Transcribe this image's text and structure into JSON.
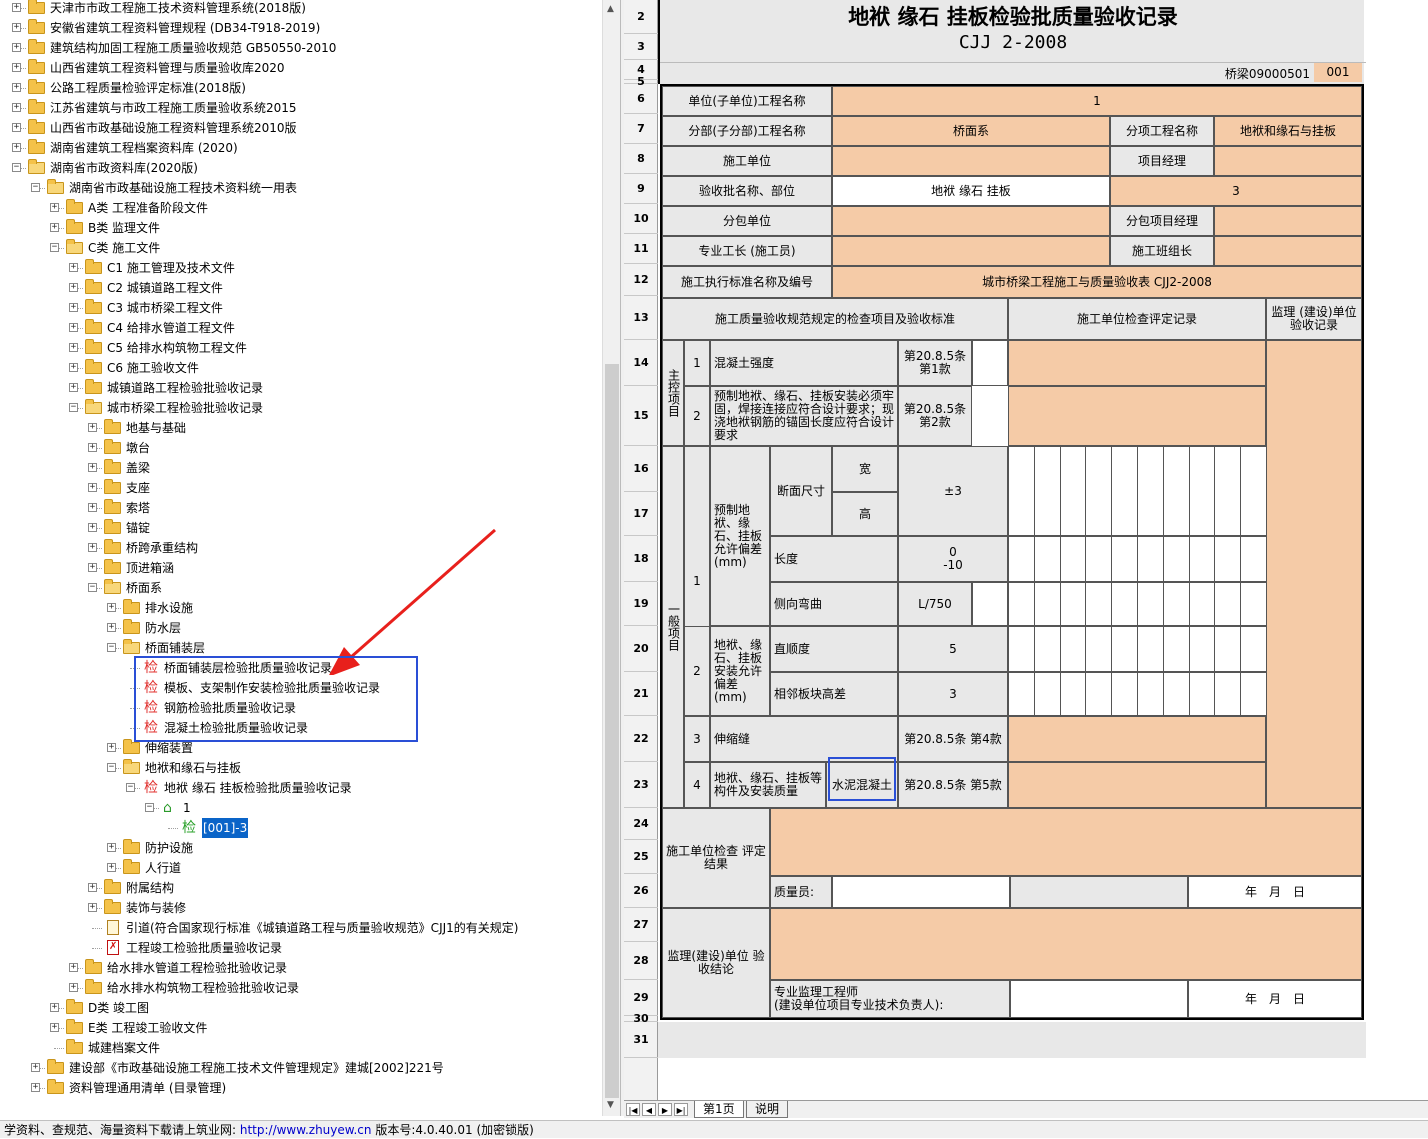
{
  "tree": {
    "items": [
      {
        "label": "天津市市政工程施工技术资料管理系统(2018版)"
      },
      {
        "label": "安徽省建筑工程资料管理规程 (DB34-T918-2019)"
      },
      {
        "label": "建筑结构加固工程施工质量验收规范 GB50550-2010"
      },
      {
        "label": "山西省建筑工程资料管理与质量验收库2020"
      },
      {
        "label": "公路工程质量检验评定标准(2018版)"
      },
      {
        "label": "江苏省建筑与市政工程施工质量验收系统2015"
      },
      {
        "label": "山西省市政基础设施工程资料管理系统2010版"
      },
      {
        "label": "湖南省建筑工程档案资料库 (2020)"
      },
      {
        "label": "湖南省市政资料库(2020版)"
      },
      {
        "label": "湖南省市政基础设施工程技术资料统一用表"
      },
      {
        "label": "A类 工程准备阶段文件"
      },
      {
        "label": "B类 监理文件"
      },
      {
        "label": "C类 施工文件"
      },
      {
        "label": "C1 施工管理及技术文件"
      },
      {
        "label": "C2 城镇道路工程文件"
      },
      {
        "label": "C3 城市桥梁工程文件"
      },
      {
        "label": "C4 给排水管道工程文件"
      },
      {
        "label": "C5 给排水构筑物工程文件"
      },
      {
        "label": "C6 施工验收文件"
      },
      {
        "label": "城镇道路工程检验批验收记录"
      },
      {
        "label": "城市桥梁工程检验批验收记录"
      },
      {
        "label": "地基与基础"
      },
      {
        "label": "墩台"
      },
      {
        "label": "盖梁"
      },
      {
        "label": "支座"
      },
      {
        "label": "索塔"
      },
      {
        "label": "锚锭"
      },
      {
        "label": "桥跨承重结构"
      },
      {
        "label": "顶进箱涵"
      },
      {
        "label": "桥面系"
      },
      {
        "label": "排水设施"
      },
      {
        "label": "防水层"
      },
      {
        "label": "桥面铺装层"
      },
      {
        "label": "桥面铺装层检验批质量验收记录"
      },
      {
        "label": "模板、支架制作安装检验批质量验收记录"
      },
      {
        "label": "钢筋检验批质量验收记录"
      },
      {
        "label": "混凝土检验批质量验收记录"
      },
      {
        "label": "伸缩装置"
      },
      {
        "label": "地袱和缘石与挂板"
      },
      {
        "label": "地袱 缘石 挂板检验批质量验收记录"
      },
      {
        "label": "1"
      },
      {
        "label": "[001]-3"
      },
      {
        "label": "防护设施"
      },
      {
        "label": "人行道"
      },
      {
        "label": "附属结构"
      },
      {
        "label": "装饰与装修"
      },
      {
        "label": "引道(符合国家现行标准《城镇道路工程与质量验收规范》CJJ1的有关规定)"
      },
      {
        "label": "工程竣工检验批质量验收记录"
      },
      {
        "label": "给水排水管道工程检验批验收记录"
      },
      {
        "label": "给水排水构筑物工程检验批验收记录"
      },
      {
        "label": "D类 竣工图"
      },
      {
        "label": "E类 工程竣工验收文件"
      },
      {
        "label": "城建档案文件"
      },
      {
        "label": "建设部《市政基础设施工程施工技术文件管理规定》建城[2002]221号"
      },
      {
        "label": "资料管理通用清单 (目录管理)"
      }
    ],
    "jian_glyph": "检",
    "home_glyph": "⌂"
  },
  "status": {
    "prefix": "学资料、查规范、海量资料下载请上筑业网: ",
    "url": "http://www.zhuyew.cn",
    "version": "  版本号:4.0.40.01 (加密锁版)"
  },
  "sheet": {
    "row_numbers": [
      "2",
      "3",
      "4",
      "5",
      "6",
      "7",
      "8",
      "9",
      "10",
      "11",
      "12",
      "13",
      "14",
      "15",
      "16",
      "17",
      "18",
      "19",
      "20",
      "21",
      "22",
      "23",
      "24",
      "25",
      "26",
      "27",
      "28",
      "29",
      "30",
      "31"
    ],
    "title": "地袱 缘石 挂板检验批质量验收记录",
    "standard": "CJJ 2-2008",
    "code_label": "桥梁09000501",
    "code_value": "001",
    "unit_label": "单位(子单位)工程名称",
    "unit_value": "1",
    "division_label": "分部(子分部)工程名称",
    "division_value": "桥面系",
    "subitem_label": "分项工程名称",
    "subitem_value": "地袱和缘石与挂板",
    "contractor_label": "施工单位",
    "pm_label": "项目经理",
    "batch_label": "验收批名称、部位",
    "batch_value": "地袱 缘石 挂板",
    "batch_no": "3",
    "subcontractor_label": "分包单位",
    "sub_pm_label": "分包项目经理",
    "foreman_label": "专业工长 (施工员)",
    "team_label": "施工班组长",
    "exec_std_label": "施工执行标准名称及编号",
    "exec_std_value": "城市桥梁工程施工与质量验收表 CJJ2-2008",
    "hdr_items": "施工质量验收规范规定的检查项目及验收标准",
    "hdr_contractor": "施工单位检查评定记录",
    "hdr_supervisor": "监理 (建设)单位验收记录",
    "main_group": "主控项目",
    "general_group": "一般项目",
    "m1_no": "1",
    "m1_name": "混凝土强度",
    "m1_ref": "第20.8.5条 第1款",
    "m2_no": "2",
    "m2_name": "预制地袱、缘石、挂板安装必须牢固，焊接连接应符合设计要求；现浇地袱钢筋的锚固长度应符合设计要求",
    "m2_ref": "第20.8.5条 第2款",
    "g1_no": "1",
    "g1_name": "预制地袱、缘石、挂板允许偏差(mm)",
    "g1_section": "断面尺寸",
    "g1_width": "宽",
    "g1_height": "高",
    "g1_section_tol": "±3",
    "g1_length": "长度",
    "g1_length_tol": "0\n-10",
    "g1_bend": "侧向弯曲",
    "g1_bend_tol": "L/750",
    "g2_no": "2",
    "g2_name": "地袱、缘石、挂板安装允许偏差(mm)",
    "g2_straight": "直顺度",
    "g2_straight_tol": "5",
    "g2_adjacent": "相邻板块高差",
    "g2_adjacent_tol": "3",
    "g3_no": "3",
    "g3_name": "伸缩缝",
    "g3_ref": "第20.8.5条 第4款",
    "g4_no": "4",
    "g4_name": "地袱、缘石、挂板等构件及安装质量",
    "g4_extra": "水泥混凝土",
    "g4_ref": "第20.8.5条 第5款",
    "check_result_label": "施工单位检查 评定结果",
    "qc_label": "质量员:",
    "date_label": "年　月　日",
    "supervisor_label": "监理(建设)单位 验收结论",
    "engineer_label": "专业监理工程师\n(建设单位项目专业技术负责人):"
  },
  "tabs": [
    "第1页",
    "说明"
  ]
}
